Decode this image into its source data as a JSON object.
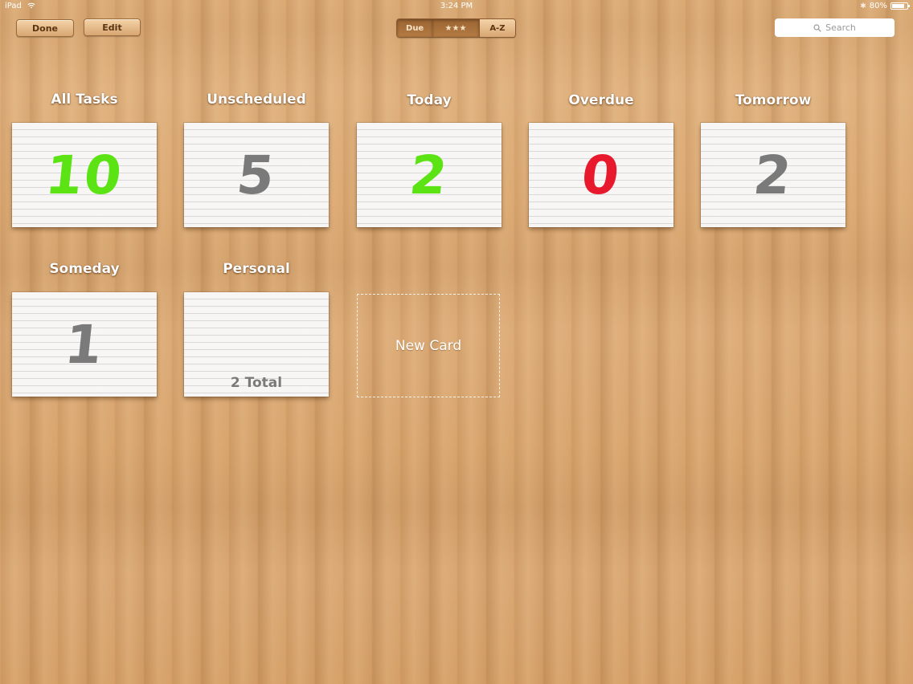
{
  "status_bar": {
    "carrier": "iPad",
    "time": "3:24 PM",
    "battery": "80%"
  },
  "toolbar": {
    "done_label": "Done",
    "edit_label": "Edit",
    "sort_options": [
      "Due",
      "★★★",
      "A-Z"
    ],
    "selected_sort": "Due",
    "search_placeholder": "Search"
  },
  "colors": {
    "green": "#5ce314",
    "red": "#e8192c",
    "gray": "#7a7a7a"
  },
  "cards": [
    {
      "label": "All Tasks",
      "count": "10",
      "color": "green"
    },
    {
      "label": "Unscheduled",
      "count": "5",
      "color": "gray"
    },
    {
      "label": "Today",
      "count": "2",
      "color": "green"
    },
    {
      "label": "Overdue",
      "count": "0",
      "color": "red"
    },
    {
      "label": "Tomorrow",
      "count": "2",
      "color": "gray"
    },
    {
      "label": "Someday",
      "count": "1",
      "color": "gray"
    },
    {
      "label": "Personal",
      "total": "2 Total"
    }
  ],
  "new_card_label": "New Card"
}
